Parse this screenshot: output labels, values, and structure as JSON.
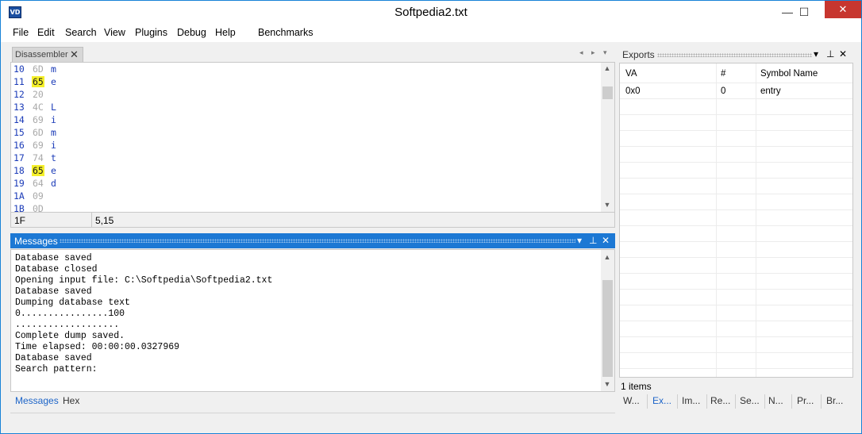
{
  "window": {
    "title": "Softpedia2.txt",
    "icon_text": "VD",
    "minimize": "—",
    "maximize": "☐",
    "close": "✕"
  },
  "menu": [
    "File",
    "Edit",
    "Search",
    "View",
    "Plugins",
    "Debug",
    "Help",
    "Benchmarks"
  ],
  "disassembler": {
    "tab_label": "Disassembler",
    "tab_close": "✕",
    "nav_left": "◂",
    "nav_right": "▸",
    "nav_down": "▾",
    "rows": [
      {
        "addr": "10",
        "hex": "6D",
        "chr": "m",
        "hl": false
      },
      {
        "addr": "11",
        "hex": "65",
        "chr": "e",
        "hl": true
      },
      {
        "addr": "12",
        "hex": "20",
        "chr": "",
        "hl": false
      },
      {
        "addr": "13",
        "hex": "4C",
        "chr": "L",
        "hl": false
      },
      {
        "addr": "14",
        "hex": "69",
        "chr": "i",
        "hl": false
      },
      {
        "addr": "15",
        "hex": "6D",
        "chr": "m",
        "hl": false
      },
      {
        "addr": "16",
        "hex": "69",
        "chr": "i",
        "hl": false
      },
      {
        "addr": "17",
        "hex": "74",
        "chr": "t",
        "hl": false
      },
      {
        "addr": "18",
        "hex": "65",
        "chr": "e",
        "hl": true
      },
      {
        "addr": "19",
        "hex": "64",
        "chr": "d",
        "hl": false
      },
      {
        "addr": "1A",
        "hex": "09",
        "chr": "",
        "hl": false
      },
      {
        "addr": "1B",
        "hex": "0D",
        "chr": "",
        "hl": false
      }
    ],
    "scroll_up": "▲",
    "scroll_down": "▼",
    "status_offset": "1F",
    "status_position": "5,15"
  },
  "messages": {
    "title": "Messages",
    "pin": "▾",
    "autohide": "⊥",
    "close": "✕",
    "lines": [
      "Database saved",
      "Database closed",
      "Opening input file: C:\\Softpedia\\Softpedia2.txt",
      "Database saved",
      "Dumping database text",
      "0................100",
      "...................",
      "Complete dump saved.",
      "Time elapsed: 00:00:00.0327969",
      "Database saved",
      "Search pattern:"
    ],
    "tabs": [
      "Messages",
      "Hex"
    ]
  },
  "exports": {
    "title": "Exports",
    "pin": "▾",
    "autohide": "⊥",
    "close": "✕",
    "columns": [
      "VA",
      "#",
      "Symbol Name"
    ],
    "rows": [
      {
        "va": "0x0",
        "num": "0",
        "name": "entry"
      }
    ],
    "items_status": "1 items",
    "tabs": [
      "W...",
      "Ex...",
      "Im...",
      "Re...",
      "Se...",
      "N...",
      "Pr...",
      "Br..."
    ]
  },
  "colors": {
    "accent": "#1c78d4",
    "highlight": "#f5f02a",
    "address_blue": "#1c3cb8",
    "close_red": "#c7362f"
  }
}
